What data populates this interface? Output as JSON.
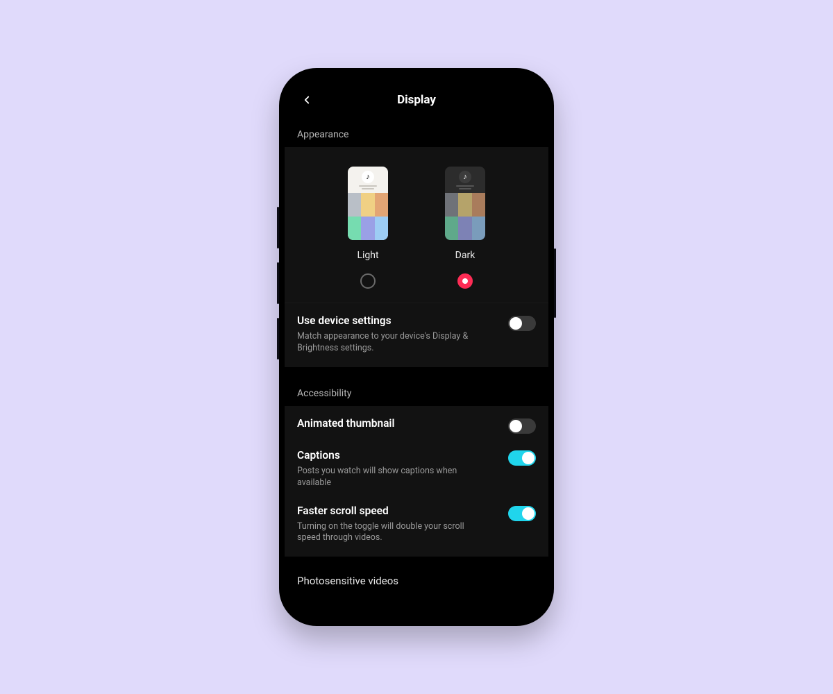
{
  "header": {
    "title": "Display"
  },
  "sections": {
    "appearance": {
      "label": "Appearance",
      "options": {
        "light": {
          "label": "Light",
          "selected": false
        },
        "dark": {
          "label": "Dark",
          "selected": true
        }
      },
      "useDevice": {
        "title": "Use device settings",
        "desc": "Match appearance to your device's Display & Brightness settings.",
        "on": false
      }
    },
    "accessibility": {
      "label": "Accessibility",
      "animatedThumbnail": {
        "title": "Animated thumbnail",
        "on": false
      },
      "captions": {
        "title": "Captions",
        "desc": "Posts you watch will show captions when available",
        "on": true
      },
      "fasterScroll": {
        "title": "Faster scroll speed",
        "desc": "Turning on the toggle will double your scroll speed through videos.",
        "on": true
      }
    },
    "photosensitive": {
      "label": "Photosensitive videos"
    }
  },
  "colors": {
    "accentRed": "#FE2C55",
    "accentTeal": "#20D5EC",
    "panel": "#121212",
    "pageBg": "#E0DAFB"
  }
}
